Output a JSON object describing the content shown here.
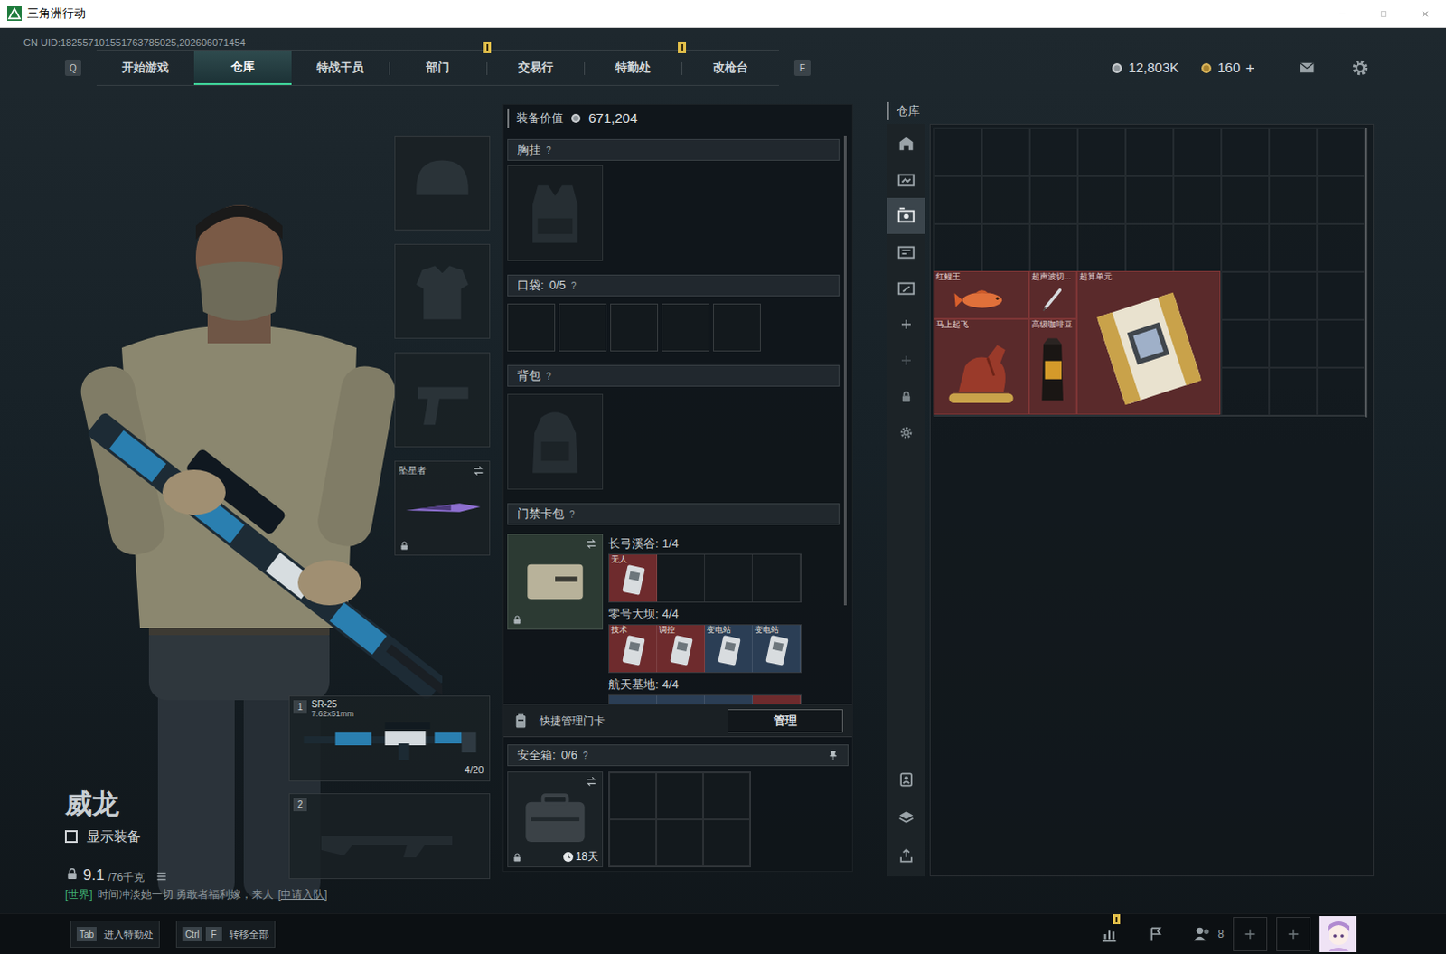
{
  "window": {
    "title": "三角洲行动"
  },
  "uid": "CN UID:182557101551763785025,202606071454",
  "nav": {
    "prev_key": "Q",
    "next_key": "E",
    "tabs": [
      {
        "label": "开始游戏",
        "selected": false,
        "badge": false
      },
      {
        "label": "仓库",
        "selected": true,
        "badge": false
      },
      {
        "label": "特战干员",
        "selected": false,
        "badge": false
      },
      {
        "label": "部门",
        "selected": false,
        "badge": true
      },
      {
        "label": "交易行",
        "selected": false,
        "badge": false
      },
      {
        "label": "特勤处",
        "selected": false,
        "badge": true
      },
      {
        "label": "改枪台",
        "selected": false,
        "badge": false
      }
    ]
  },
  "currency": {
    "coins": "12,803K",
    "tokens": "160",
    "add": "+"
  },
  "character": {
    "name": "威龙",
    "show_gear": {
      "label": "显示装备",
      "checked": false
    },
    "weight": "9.1",
    "capacity": "/76千克"
  },
  "gear_slots": [
    {
      "kind": "helmet",
      "filled": false
    },
    {
      "kind": "armor",
      "filled": false
    },
    {
      "kind": "pistol",
      "filled": false
    },
    {
      "kind": "melee",
      "filled": true,
      "label": "坠星者",
      "locked": true
    }
  ],
  "weapons": [
    {
      "slot": "1",
      "filled": true,
      "name": "SR-25",
      "caliber": "7.62x51mm",
      "ammo": "4/20"
    },
    {
      "slot": "2",
      "filled": false
    }
  ],
  "chat": {
    "channel": "[世界]",
    "message": "时间冲淡她一切 勇敢者福利嫁，来人",
    "action": "[申请入队]"
  },
  "loadout": {
    "value_label": "装备价值",
    "value": "671,204",
    "chest": {
      "title": "胸挂",
      "help": "?"
    },
    "pockets": {
      "title": "口袋:",
      "count": "0/5",
      "help": "?",
      "slots": [
        {
          "filled": false
        },
        {
          "filled": false
        },
        {
          "filled": false
        },
        {
          "filled": false
        },
        {
          "filled": false
        }
      ]
    },
    "backpack": {
      "title": "背包",
      "help": "?"
    },
    "keycards": {
      "title": "门禁卡包",
      "help": "?",
      "locked": true,
      "regions": [
        {
          "name": "长弓溪谷:",
          "count": "1/4",
          "cards": [
            {
              "label": "无人",
              "filled": true,
              "color": "#6e2b2d"
            },
            {
              "filled": false
            },
            {
              "filled": false
            },
            {
              "filled": false
            }
          ]
        },
        {
          "name": "零号大坝:",
          "count": "4/4",
          "cards": [
            {
              "label": "技术",
              "filled": true,
              "color": "#6e2b2d"
            },
            {
              "label": "调控",
              "filled": true,
              "color": "#6e2b2d"
            },
            {
              "label": "变电站",
              "filled": true,
              "color": "#2b3e55"
            },
            {
              "label": "变电站",
              "filled": true,
              "color": "#2b3e55"
            }
          ]
        },
        {
          "name": "航天基地:",
          "count": "4/4",
          "cards": [
            {
              "filled": true,
              "color": "#2b3e55"
            },
            {
              "filled": true,
              "color": "#2b3e55"
            },
            {
              "filled": true,
              "color": "#2b3e55"
            },
            {
              "filled": true,
              "color": "#6e2b2d"
            }
          ]
        }
      ]
    },
    "quick_manage": {
      "label": "快捷管理门卡",
      "button": "管理"
    },
    "safe_box": {
      "title": "安全箱:",
      "count": "0/6",
      "help": "?",
      "timer": "18天",
      "locked": true,
      "slots": [
        {
          "filled": false
        },
        {
          "filled": false
        },
        {
          "filled": false
        },
        {
          "filled": false
        },
        {
          "filled": false
        },
        {
          "filled": false
        }
      ]
    }
  },
  "warehouse": {
    "title": "仓库",
    "columns": 9,
    "rows": 6,
    "tabs": [
      {
        "selected": false
      },
      {
        "selected": false
      },
      {
        "selected": true
      },
      {
        "selected": false
      },
      {
        "selected": false
      }
    ],
    "items": [
      {
        "label": "红鲤王",
        "kind": "fish",
        "col": 1,
        "row": 4,
        "w": 2,
        "h": 1
      },
      {
        "label": "超声波切...",
        "kind": "pen",
        "col": 3,
        "row": 4,
        "w": 1,
        "h": 1
      },
      {
        "label": "超算单元",
        "kind": "board",
        "col": 4,
        "row": 4,
        "w": 3,
        "h": 3
      },
      {
        "label": "马上起飞",
        "kind": "horse",
        "col": 1,
        "row": 5,
        "w": 2,
        "h": 2
      },
      {
        "label": "高级咖啡豆",
        "kind": "coffee",
        "col": 3,
        "row": 5,
        "w": 1,
        "h": 2
      }
    ]
  },
  "bottom_bar": {
    "hints": [
      {
        "keys": [
          "Tab"
        ],
        "label": "进入特勤处"
      },
      {
        "keys": [
          "Ctrl",
          "F"
        ],
        "label": "转移全部"
      }
    ],
    "stats_badge": true,
    "friends": "8"
  }
}
